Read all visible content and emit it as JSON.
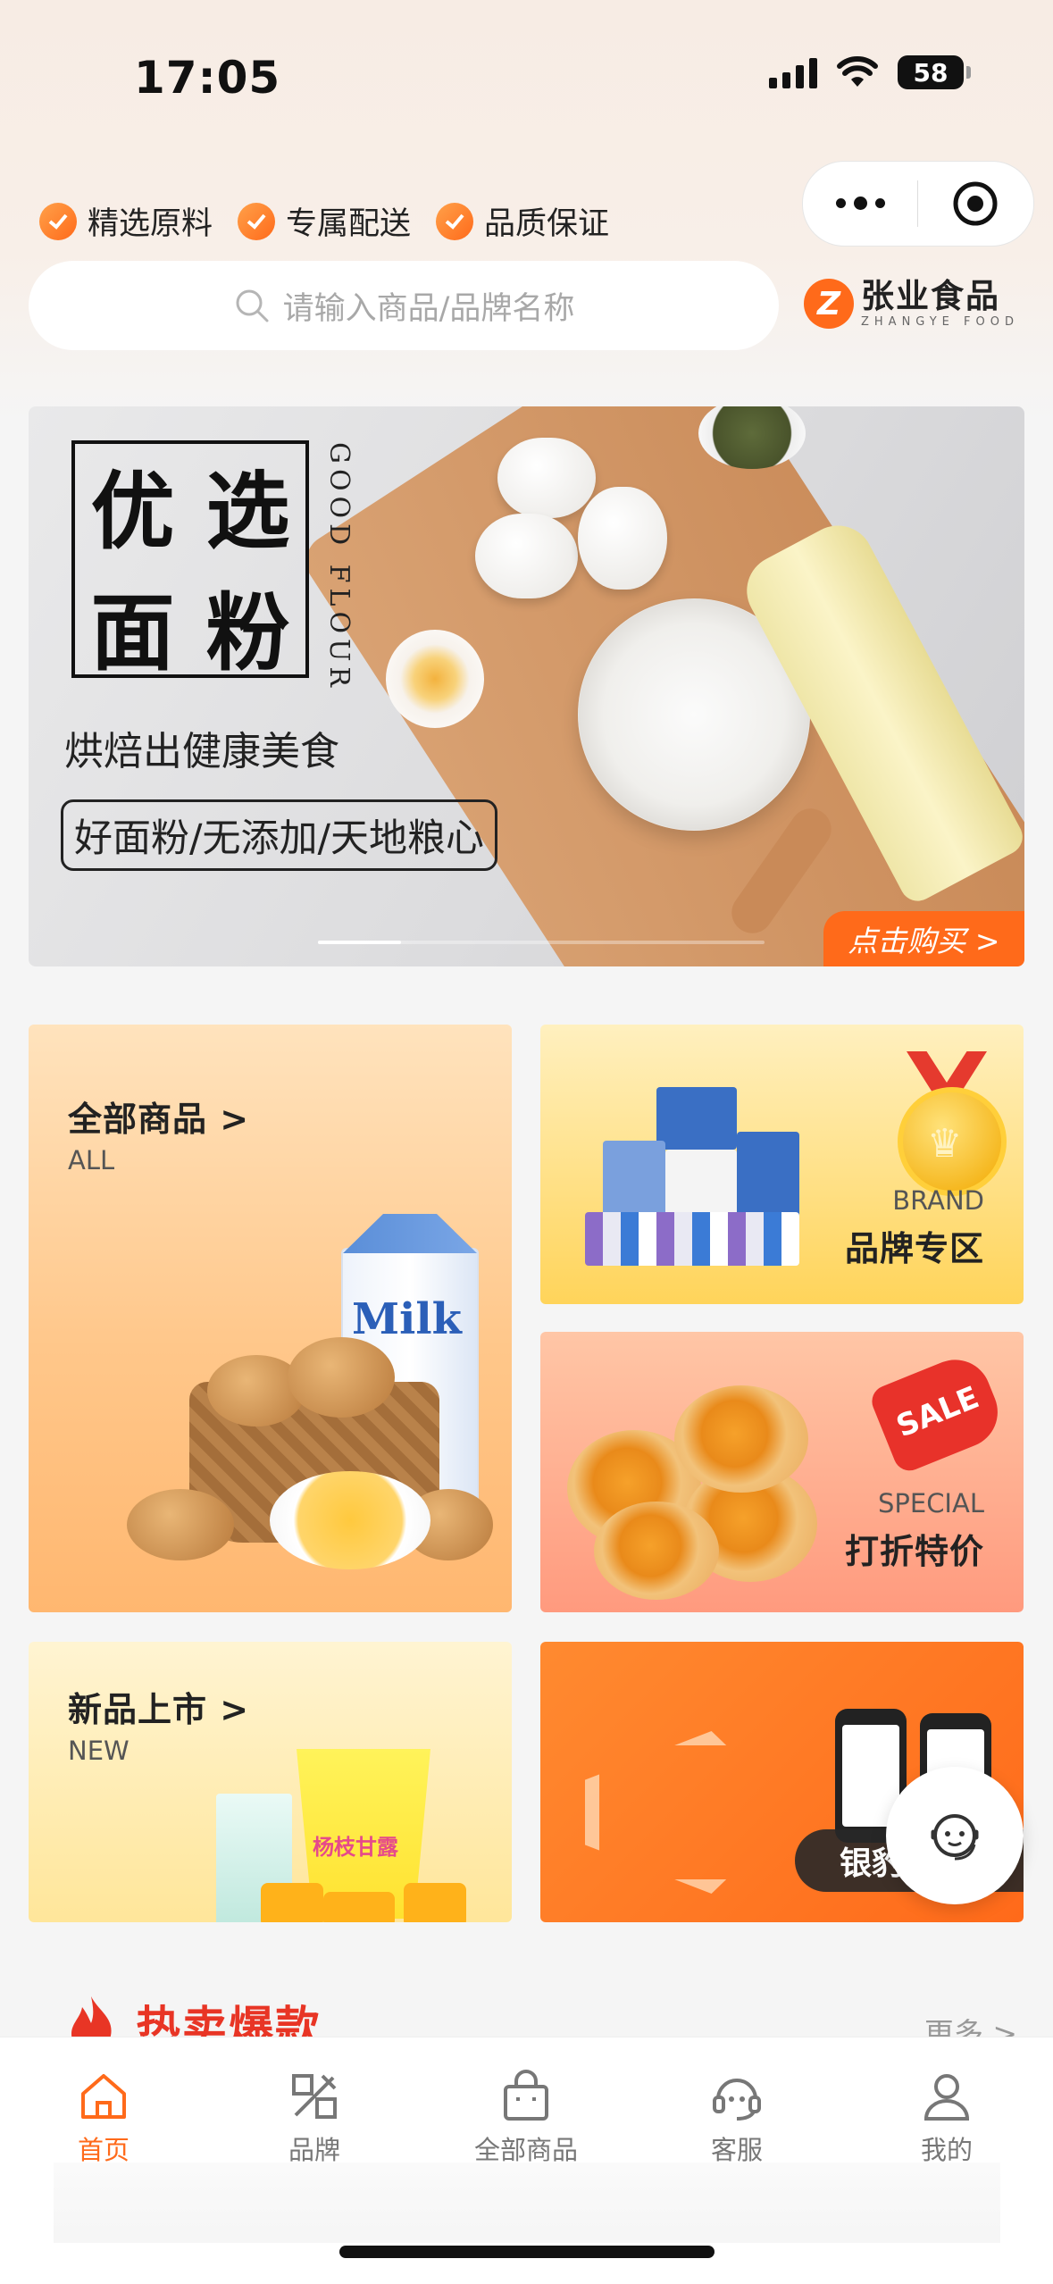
{
  "status": {
    "time": "17:05",
    "battery": "58"
  },
  "features": [
    "精选原料",
    "专属配送",
    "品质保证"
  ],
  "search": {
    "placeholder": "请输入商品/品牌名称"
  },
  "logo": {
    "cn": "张业食品",
    "en": "ZHANGYE FOOD"
  },
  "banner": {
    "title_chars": [
      "优",
      "选",
      "面",
      "粉"
    ],
    "vertical": "GOOD FLOUR",
    "subtitle": "烘焙出健康美食",
    "tags": "好面粉/无添加/天地粮心",
    "cta": "点击购买 >"
  },
  "cards": {
    "all": {
      "title": "全部商品 >",
      "sub": "ALL",
      "milk": "Milk"
    },
    "brand": {
      "sub": "BRAND",
      "title": "品牌专区"
    },
    "sale": {
      "sub": "SPECIAL",
      "title": "打折特价",
      "tag": "SALE"
    },
    "new": {
      "title": "新品上市 >",
      "sub": "NEW",
      "cup_label": "杨枝甘露"
    },
    "promo": {
      "label": "银豹"
    }
  },
  "hot": {
    "title": "热卖爆款",
    "more": "更多 >"
  },
  "tabs": [
    {
      "label": "首页",
      "icon": "home-icon",
      "active": true
    },
    {
      "label": "品牌",
      "icon": "brand-icon",
      "active": false
    },
    {
      "label": "全部商品",
      "icon": "bag-icon",
      "active": false
    },
    {
      "label": "客服",
      "icon": "headset-icon",
      "active": false
    },
    {
      "label": "我的",
      "icon": "user-icon",
      "active": false
    }
  ],
  "colors": {
    "accent": "#ff6a1a",
    "hot": "#e83525"
  }
}
